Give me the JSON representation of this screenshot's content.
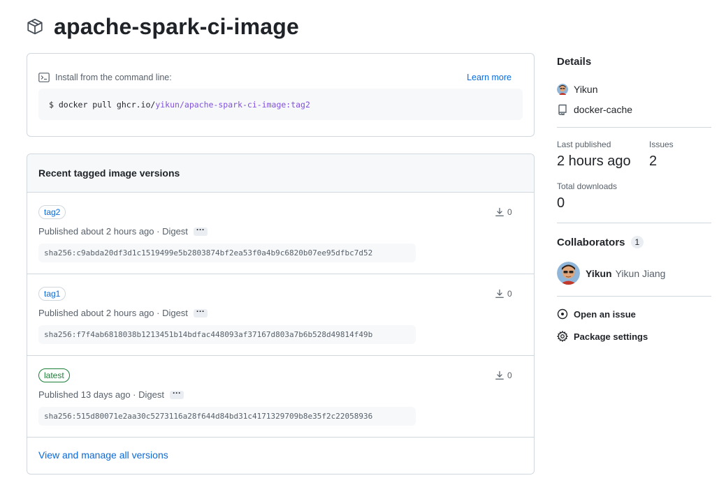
{
  "package": {
    "name": "apache-spark-ci-image",
    "icon": "package-icon"
  },
  "install": {
    "label": "Install from the command line:",
    "learn_more": "Learn more",
    "command_prefix": "$ docker pull ghcr.io/",
    "command_owner": "yikun",
    "command_sep": "/",
    "command_image": "apache-spark-ci-image:tag2"
  },
  "versions": {
    "title": "Recent tagged image versions",
    "items": [
      {
        "tag": "tag2",
        "published": "Published about 2 hours ago · Digest",
        "ellipsis": "···",
        "downloads": "0",
        "digest": "sha256:c9abda20df3d1c1519499e5b2803874bf2ea53f0a4b9c6820b07ee95dfbc7d52"
      },
      {
        "tag": "tag1",
        "published": "Published about 2 hours ago · Digest",
        "ellipsis": "···",
        "downloads": "0",
        "digest": "sha256:f7f4ab6818038b1213451b14bdfac448093af37167d803a7b6b528d49814f49b"
      },
      {
        "tag": "latest",
        "published": "Published 13 days ago · Digest",
        "ellipsis": "···",
        "downloads": "0",
        "digest": "sha256:515d80071e2aa30c5273116a28f644d84bd31c4171329709b8e35f2c22058936"
      }
    ],
    "view_all": "View and manage all versions"
  },
  "sidebar": {
    "details_title": "Details",
    "owner": "Yikun",
    "repo": "docker-cache",
    "last_published_label": "Last published",
    "last_published_value": "2 hours ago",
    "issues_label": "Issues",
    "issues_value": "2",
    "total_downloads_label": "Total downloads",
    "total_downloads_value": "0",
    "collaborators_title": "Collaborators",
    "collaborators_count": "1",
    "collaborator_login": "Yikun",
    "collaborator_name": "Yikun Jiang",
    "open_issue": "Open an issue",
    "package_settings": "Package settings"
  },
  "colors": {
    "link": "#0969da",
    "latest": "#1a7f37",
    "border": "#d0d7de",
    "muted": "#57606a",
    "purple_link": "#8250df"
  }
}
